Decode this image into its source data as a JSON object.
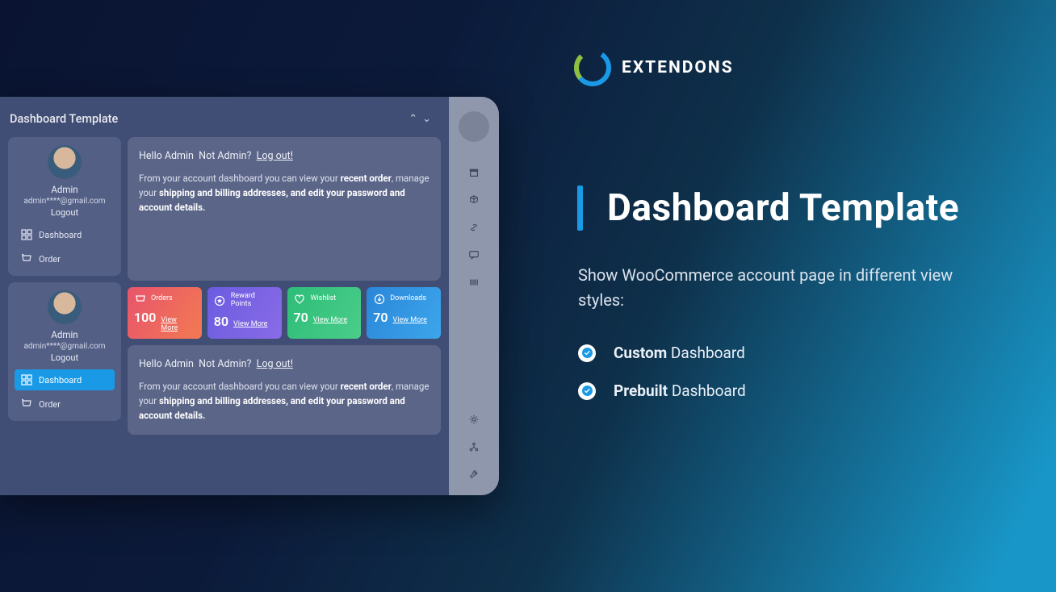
{
  "logo": {
    "text": "EXTENDONS"
  },
  "headline": "Dashboard Template",
  "subtext": "Show WooCommerce account page in different view styles:",
  "checklist": [
    {
      "strong": "Custom",
      "rest": " Dashboard"
    },
    {
      "strong": "Prebuilt",
      "rest": " Dashboard"
    }
  ],
  "window": {
    "title": "Dashboard Template",
    "user1": {
      "name": "Admin",
      "email": "admin****@gmail.com",
      "logout": "Logout",
      "nav": {
        "dashboard": "Dashboard",
        "order": "Order"
      }
    },
    "user2": {
      "name": "Admin",
      "email": "admin****@gmail.com",
      "logout": "Logout",
      "nav": {
        "dashboard": "Dashboard",
        "order": "Order"
      }
    },
    "greet": {
      "hello": "Hello Admin",
      "notadmin": "Not Admin?",
      "logout": "Log out!",
      "body_pre": "From your account dashboard you can view your ",
      "b1": "recent order",
      "body_mid": ", manage your ",
      "b2": "shipping and billing addresses, and edit your password and account details."
    },
    "stats": {
      "orders": {
        "label": "Orders",
        "value": "100",
        "link": "View More"
      },
      "reward": {
        "label": "Reward Points",
        "value": "80",
        "link": "View More"
      },
      "wish": {
        "label": "Wishlist",
        "value": "70",
        "link": "View More"
      },
      "down": {
        "label": "Downloads",
        "value": "70",
        "link": "View More"
      }
    }
  }
}
